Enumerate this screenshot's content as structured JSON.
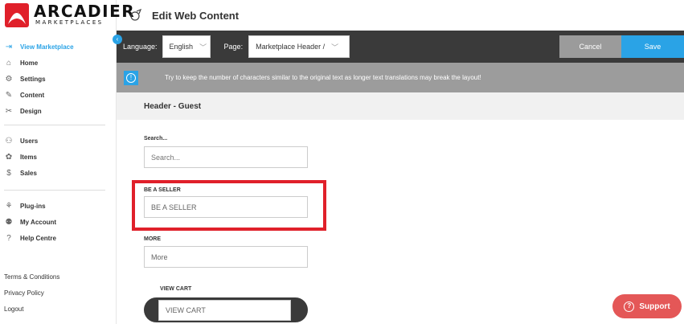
{
  "brand": {
    "name": "ARCADIER",
    "sub": "MARKETPLACES",
    "logo_color": "#e0202a"
  },
  "sidebar": {
    "group1": [
      {
        "label": "View Marketplace",
        "icon": "arrow-right-box-icon",
        "glyph": "⇥",
        "active": true
      },
      {
        "label": "Home",
        "icon": "home-icon",
        "glyph": "⌂"
      },
      {
        "label": "Settings",
        "icon": "gear-icon",
        "glyph": "⚙"
      },
      {
        "label": "Content",
        "icon": "content-icon",
        "glyph": "✎"
      },
      {
        "label": "Design",
        "icon": "design-icon",
        "glyph": "✂"
      }
    ],
    "group2": [
      {
        "label": "Users",
        "icon": "user-icon",
        "glyph": "⚇"
      },
      {
        "label": "Items",
        "icon": "items-icon",
        "glyph": "✿"
      },
      {
        "label": "Sales",
        "icon": "sales-icon",
        "glyph": "$"
      }
    ],
    "group3": [
      {
        "label": "Plug-ins",
        "icon": "plugin-icon",
        "glyph": "⚘"
      },
      {
        "label": "My Account",
        "icon": "account-icon",
        "glyph": "⚉"
      },
      {
        "label": "Help Centre",
        "icon": "help-icon",
        "glyph": "?"
      }
    ],
    "footer": [
      "Terms & Conditions",
      "Privacy Policy",
      "Logout"
    ]
  },
  "header": {
    "title": "Edit Web Content"
  },
  "toolbar": {
    "language_label": "Language:",
    "language_value": "English",
    "page_label": "Page:",
    "page_value": "Marketplace Header /",
    "cancel_label": "Cancel",
    "save_label": "Save"
  },
  "info": {
    "text": "Try to keep the number of characters similar to the original text as longer text translations may break the layout!"
  },
  "section": {
    "title": "Header - Guest"
  },
  "fields": {
    "search": {
      "label": "Search...",
      "placeholder": "Search..."
    },
    "seller": {
      "label": "BE A SELLER",
      "value": "BE A SELLER"
    },
    "more": {
      "label": "MORE",
      "value": "More"
    },
    "cart": {
      "label": "VIEW CART",
      "value": "VIEW CART"
    }
  },
  "support": {
    "label": "Support"
  },
  "colors": {
    "accent": "#2aa3e6",
    "highlight": "#e0202a",
    "toolbar": "#3a3a3a",
    "support": "#e45757"
  }
}
